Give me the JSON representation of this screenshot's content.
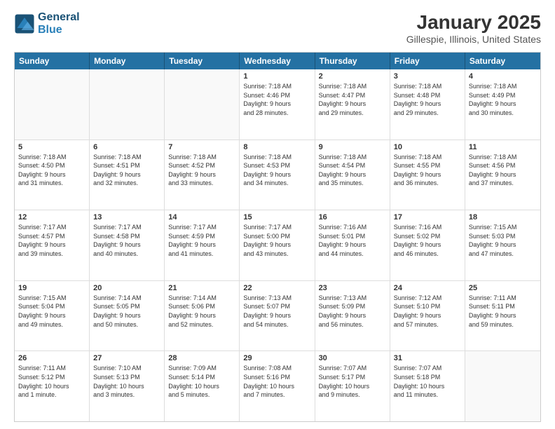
{
  "header": {
    "logo_line1": "General",
    "logo_line2": "Blue",
    "title": "January 2025",
    "subtitle": "Gillespie, Illinois, United States"
  },
  "weekdays": [
    "Sunday",
    "Monday",
    "Tuesday",
    "Wednesday",
    "Thursday",
    "Friday",
    "Saturday"
  ],
  "weeks": [
    [
      {
        "day": "",
        "info": ""
      },
      {
        "day": "",
        "info": ""
      },
      {
        "day": "",
        "info": ""
      },
      {
        "day": "1",
        "info": "Sunrise: 7:18 AM\nSunset: 4:46 PM\nDaylight: 9 hours\nand 28 minutes."
      },
      {
        "day": "2",
        "info": "Sunrise: 7:18 AM\nSunset: 4:47 PM\nDaylight: 9 hours\nand 29 minutes."
      },
      {
        "day": "3",
        "info": "Sunrise: 7:18 AM\nSunset: 4:48 PM\nDaylight: 9 hours\nand 29 minutes."
      },
      {
        "day": "4",
        "info": "Sunrise: 7:18 AM\nSunset: 4:49 PM\nDaylight: 9 hours\nand 30 minutes."
      }
    ],
    [
      {
        "day": "5",
        "info": "Sunrise: 7:18 AM\nSunset: 4:50 PM\nDaylight: 9 hours\nand 31 minutes."
      },
      {
        "day": "6",
        "info": "Sunrise: 7:18 AM\nSunset: 4:51 PM\nDaylight: 9 hours\nand 32 minutes."
      },
      {
        "day": "7",
        "info": "Sunrise: 7:18 AM\nSunset: 4:52 PM\nDaylight: 9 hours\nand 33 minutes."
      },
      {
        "day": "8",
        "info": "Sunrise: 7:18 AM\nSunset: 4:53 PM\nDaylight: 9 hours\nand 34 minutes."
      },
      {
        "day": "9",
        "info": "Sunrise: 7:18 AM\nSunset: 4:54 PM\nDaylight: 9 hours\nand 35 minutes."
      },
      {
        "day": "10",
        "info": "Sunrise: 7:18 AM\nSunset: 4:55 PM\nDaylight: 9 hours\nand 36 minutes."
      },
      {
        "day": "11",
        "info": "Sunrise: 7:18 AM\nSunset: 4:56 PM\nDaylight: 9 hours\nand 37 minutes."
      }
    ],
    [
      {
        "day": "12",
        "info": "Sunrise: 7:17 AM\nSunset: 4:57 PM\nDaylight: 9 hours\nand 39 minutes."
      },
      {
        "day": "13",
        "info": "Sunrise: 7:17 AM\nSunset: 4:58 PM\nDaylight: 9 hours\nand 40 minutes."
      },
      {
        "day": "14",
        "info": "Sunrise: 7:17 AM\nSunset: 4:59 PM\nDaylight: 9 hours\nand 41 minutes."
      },
      {
        "day": "15",
        "info": "Sunrise: 7:17 AM\nSunset: 5:00 PM\nDaylight: 9 hours\nand 43 minutes."
      },
      {
        "day": "16",
        "info": "Sunrise: 7:16 AM\nSunset: 5:01 PM\nDaylight: 9 hours\nand 44 minutes."
      },
      {
        "day": "17",
        "info": "Sunrise: 7:16 AM\nSunset: 5:02 PM\nDaylight: 9 hours\nand 46 minutes."
      },
      {
        "day": "18",
        "info": "Sunrise: 7:15 AM\nSunset: 5:03 PM\nDaylight: 9 hours\nand 47 minutes."
      }
    ],
    [
      {
        "day": "19",
        "info": "Sunrise: 7:15 AM\nSunset: 5:04 PM\nDaylight: 9 hours\nand 49 minutes."
      },
      {
        "day": "20",
        "info": "Sunrise: 7:14 AM\nSunset: 5:05 PM\nDaylight: 9 hours\nand 50 minutes."
      },
      {
        "day": "21",
        "info": "Sunrise: 7:14 AM\nSunset: 5:06 PM\nDaylight: 9 hours\nand 52 minutes."
      },
      {
        "day": "22",
        "info": "Sunrise: 7:13 AM\nSunset: 5:07 PM\nDaylight: 9 hours\nand 54 minutes."
      },
      {
        "day": "23",
        "info": "Sunrise: 7:13 AM\nSunset: 5:09 PM\nDaylight: 9 hours\nand 56 minutes."
      },
      {
        "day": "24",
        "info": "Sunrise: 7:12 AM\nSunset: 5:10 PM\nDaylight: 9 hours\nand 57 minutes."
      },
      {
        "day": "25",
        "info": "Sunrise: 7:11 AM\nSunset: 5:11 PM\nDaylight: 9 hours\nand 59 minutes."
      }
    ],
    [
      {
        "day": "26",
        "info": "Sunrise: 7:11 AM\nSunset: 5:12 PM\nDaylight: 10 hours\nand 1 minute."
      },
      {
        "day": "27",
        "info": "Sunrise: 7:10 AM\nSunset: 5:13 PM\nDaylight: 10 hours\nand 3 minutes."
      },
      {
        "day": "28",
        "info": "Sunrise: 7:09 AM\nSunset: 5:14 PM\nDaylight: 10 hours\nand 5 minutes."
      },
      {
        "day": "29",
        "info": "Sunrise: 7:08 AM\nSunset: 5:16 PM\nDaylight: 10 hours\nand 7 minutes."
      },
      {
        "day": "30",
        "info": "Sunrise: 7:07 AM\nSunset: 5:17 PM\nDaylight: 10 hours\nand 9 minutes."
      },
      {
        "day": "31",
        "info": "Sunrise: 7:07 AM\nSunset: 5:18 PM\nDaylight: 10 hours\nand 11 minutes."
      },
      {
        "day": "",
        "info": ""
      }
    ]
  ]
}
